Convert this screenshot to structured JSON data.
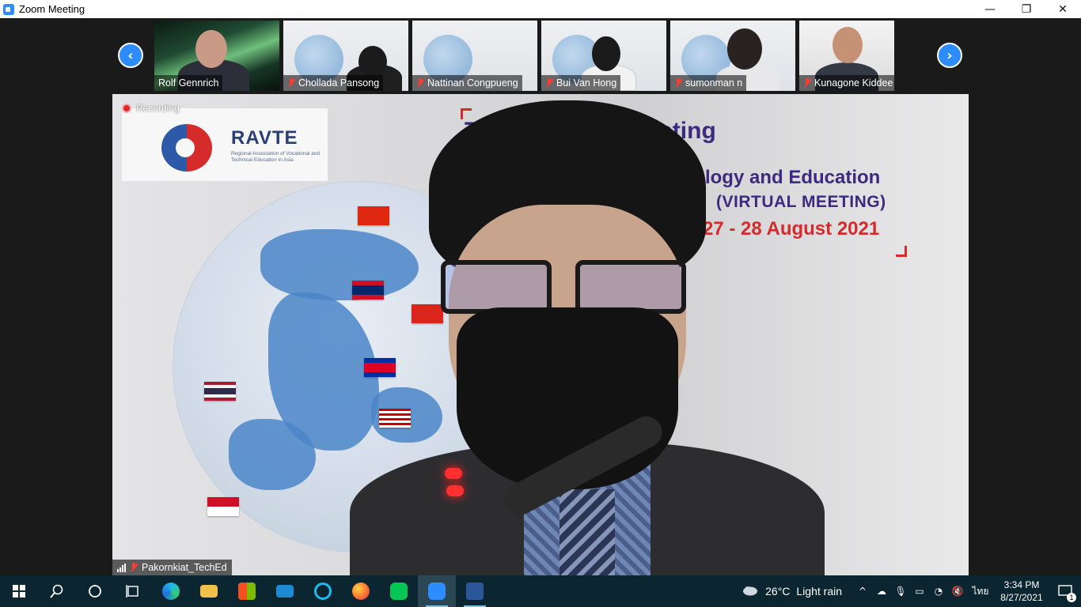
{
  "window": {
    "title": "Zoom Meeting",
    "min": "—",
    "restore": "❐",
    "close": "✕"
  },
  "thumbs": [
    {
      "name": "Rolf Gennrich",
      "muted": false,
      "scene": "aurora"
    },
    {
      "name": "Chollada Pansong",
      "muted": true,
      "scene": "slide"
    },
    {
      "name": "Nattinan Congpueng",
      "muted": true,
      "scene": "slide"
    },
    {
      "name": "Bui Van Hong",
      "muted": true,
      "scene": "slide"
    },
    {
      "name": "sumonman n",
      "muted": true,
      "scene": "slide"
    },
    {
      "name": "Kunagone Kiddee",
      "muted": true,
      "scene": "room"
    }
  ],
  "nav": {
    "prev": "‹",
    "next": "›"
  },
  "speaker": {
    "name": "Pakornkiat_TechEd",
    "recording_label": "Recording",
    "logo_text": "RAVTE",
    "logo_sub": "Regional Association of Vocational and Technical Education in Asia",
    "slide_title": "Th         ual RAVTE Meeting",
    "slide_sub1": "hnology and Education",
    "slide_sub2": "(VIRTUAL MEETING)",
    "slide_sub3": "27 - 28 August 2021"
  },
  "taskbar": {
    "apps": [
      "start",
      "search",
      "cortana",
      "task-view",
      "edge",
      "file-explorer",
      "store",
      "mail",
      "internet-explorer",
      "firefox",
      "line",
      "zoom",
      "word"
    ],
    "weather": {
      "temp": "26°C",
      "condition": "Light rain"
    },
    "lang": "ไทย",
    "time": "3:34 PM",
    "date": "8/27/2021",
    "notifications": "1"
  }
}
